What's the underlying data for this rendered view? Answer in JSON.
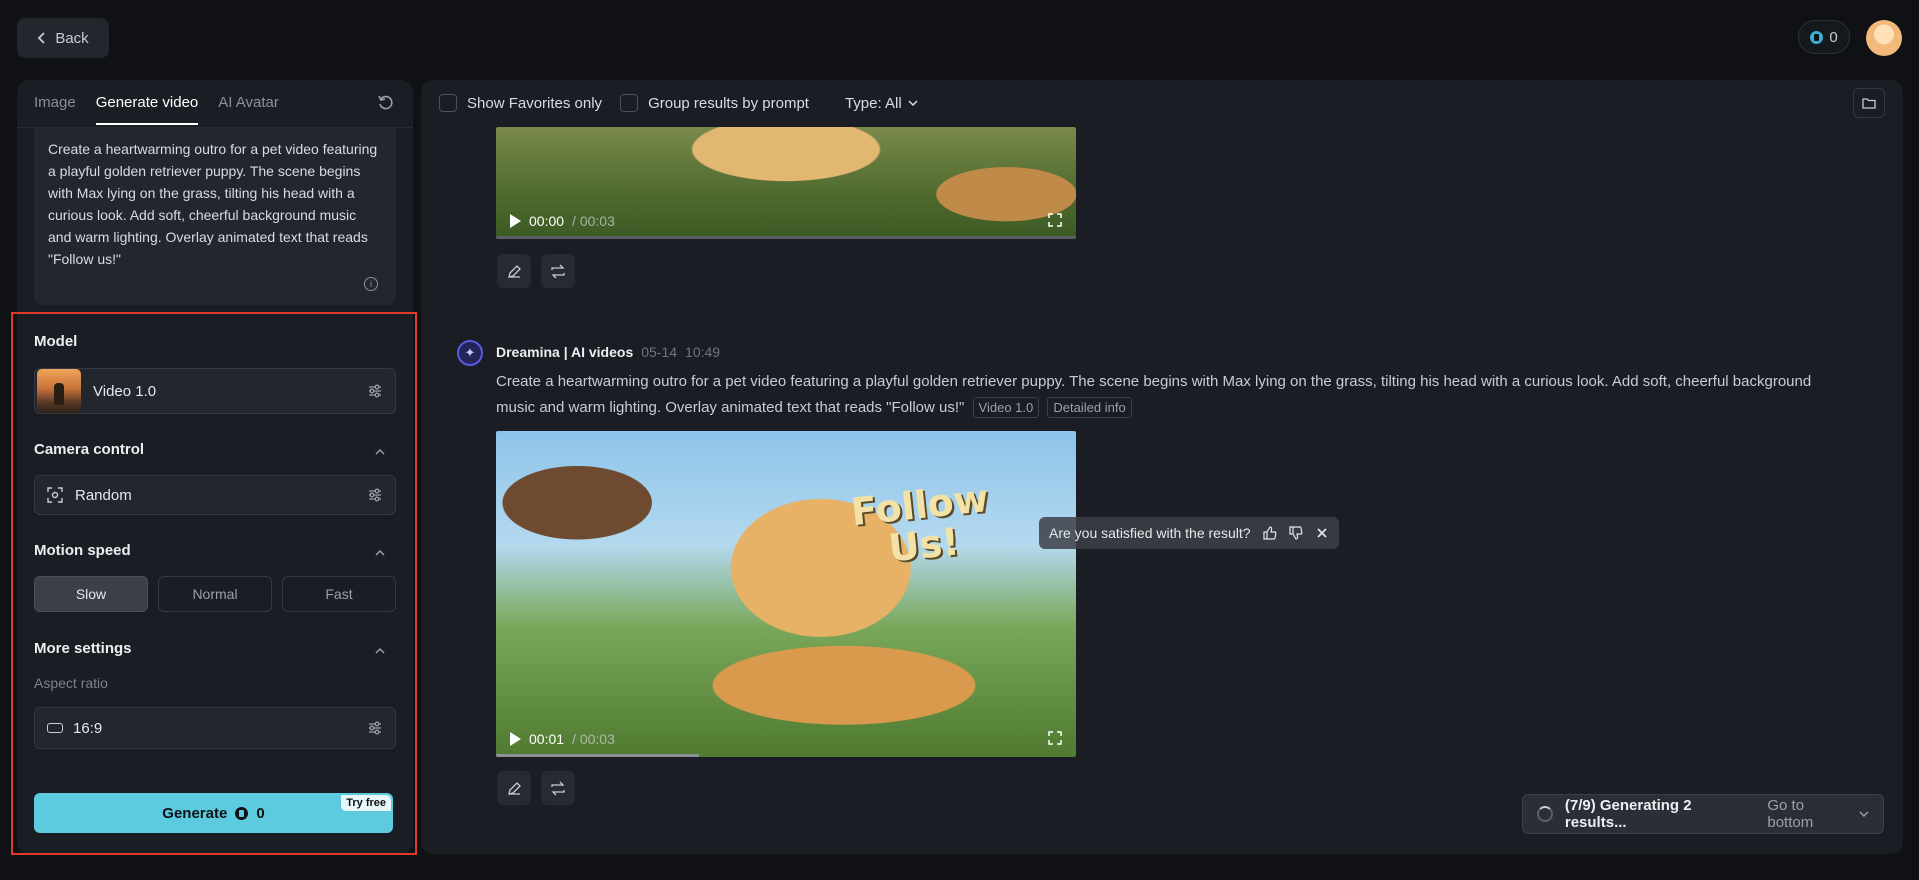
{
  "topbar": {
    "back_label": "Back",
    "credits": "0"
  },
  "left": {
    "tabs": [
      {
        "label": "Image"
      },
      {
        "label": "Generate video"
      },
      {
        "label": "AI Avatar"
      }
    ],
    "prompt": "Create a heartwarming outro for a pet video featuring a playful golden retriever puppy. The scene begins with Max lying on the grass, tilting his head with a curious look. Add soft, cheerful background music and warm lighting. Overlay animated text that reads \"Follow us!\"",
    "model": {
      "label": "Model",
      "value": "Video 1.0"
    },
    "camera": {
      "label": "Camera control",
      "value": "Random"
    },
    "motion": {
      "label": "Motion speed",
      "options": [
        "Slow",
        "Normal",
        "Fast"
      ],
      "selected": "Slow"
    },
    "more": {
      "label": "More settings",
      "aspect_label": "Aspect ratio",
      "aspect_value": "16:9"
    },
    "generate": {
      "label": "Generate",
      "cost": "0",
      "badge": "Try free"
    }
  },
  "main": {
    "filters": {
      "favorites": "Show Favorites only",
      "group": "Group results by prompt",
      "type": "Type: All"
    },
    "video1": {
      "current": "00:00",
      "duration": "00:03"
    },
    "message": {
      "author": "Dreamina | AI videos",
      "date": "05-14",
      "time": "10:49",
      "prompt": "Create a heartwarming outro for a pet video featuring a playful golden retriever puppy. The scene begins with Max lying on the grass, tilting his head with a curious look. Add soft, cheerful background music and warm lighting. Overlay animated text that reads \"Follow us!\"",
      "tag_model": "Video 1.0",
      "tag_info": "Detailed info"
    },
    "feedback": "Are you satisfied with the result?",
    "video2": {
      "overlay_text_1": "Follow",
      "overlay_text_2": "Us!",
      "current": "00:01",
      "duration": "00:03",
      "progress_pct": 35
    },
    "status": {
      "text": "(7/9) Generating 2 results...",
      "link": "Go to bottom"
    }
  },
  "colors": {
    "accent": "#5ccbe0",
    "highlight": "#e0392b",
    "panel": "#1a1d23",
    "background": "#0f1115"
  }
}
